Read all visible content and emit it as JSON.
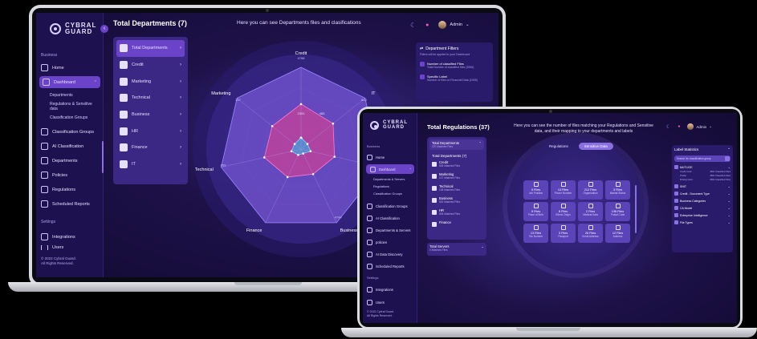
{
  "screen1": {
    "logo": {
      "line1": "CYBRAL",
      "line2": "GUARD"
    },
    "title": "Total Departments (7)",
    "subtitle": "Here you can see Departments files and clasifications",
    "user": "Admin",
    "sidebar": {
      "section_business": "Business",
      "section_settings": "Settings",
      "items": [
        {
          "label": "Home",
          "icon": "home-icon"
        },
        {
          "label": "Dashboard",
          "icon": "chart-icon",
          "active": true
        },
        {
          "label": "Classification Groups",
          "icon": "folder-icon"
        },
        {
          "label": "AI Classification",
          "icon": "ai-icon"
        },
        {
          "label": "Departments",
          "icon": "building-icon"
        },
        {
          "label": "Policies",
          "icon": "doc-icon"
        },
        {
          "label": "Regulations",
          "icon": "scale-icon"
        },
        {
          "label": "Scheduled Reports",
          "icon": "calendar-icon"
        }
      ],
      "dashboard_sub": [
        "Departments",
        "Regulations & Sensitive data",
        "Classification Groups"
      ],
      "settings_items": [
        {
          "label": "Integrations",
          "icon": "plug-icon"
        },
        {
          "label": "Users",
          "icon": "users-icon"
        }
      ],
      "footer": [
        "© 2022 Cybral Guard.",
        "All Rights Reserved."
      ]
    },
    "departments": [
      "Total Departments",
      "Credit",
      "Marketing",
      "Technical",
      "Business",
      "HR",
      "Finance",
      "IT"
    ],
    "radar": {
      "axes": [
        {
          "label": "Credit",
          "value_label": "4768"
        },
        {
          "label": "IT",
          "value_label": "843"
        },
        {
          "label": "HR",
          "value_label": ""
        },
        {
          "label": "Business",
          "value_label": "4744"
        },
        {
          "label": "Finance",
          "value_label": ""
        },
        {
          "label": "Technical",
          "value_label": "659"
        },
        {
          "label": "Marketing",
          "value_label": "357"
        }
      ],
      "ring_labels": [
        "2331",
        "483",
        "73"
      ],
      "colors": {
        "outer": "#6d4fc8",
        "classified": "#c2429a",
        "specific": "#3aa6e0"
      }
    },
    "filter": {
      "title": "Department Filters",
      "subtitle": "Filters will be applied to your Dashboard",
      "options": [
        {
          "label": "Number of classified Files",
          "sub": "Total Number of classified files (3596)"
        },
        {
          "label": "Specific Label",
          "sub": "Number of files on Financial Data (2495)"
        }
      ]
    }
  },
  "screen2": {
    "logo": {
      "line1": "CYBRAL",
      "line2": "GUARD"
    },
    "title": "Total Regulations (37)",
    "subtitle": "Here you can see the number of files matching your Regulations and Sensitive data, and their mapping to your departments and labels",
    "user": "Admin",
    "sidebar": {
      "section_business": "Business",
      "section_settings": "Settings",
      "items": [
        {
          "label": "Home",
          "icon": "home-icon"
        },
        {
          "label": "Dashboard",
          "icon": "chart-icon",
          "active": true
        },
        {
          "label": "Classification Groups",
          "icon": "folder-icon"
        },
        {
          "label": "AI Classification",
          "icon": "ai-icon"
        },
        {
          "label": "Departments & Servers",
          "icon": "building-icon"
        },
        {
          "label": "policies",
          "icon": "doc-icon"
        },
        {
          "label": "AI Data Discovery",
          "icon": "search-icon"
        },
        {
          "label": "Scheduled Reports",
          "icon": "calendar-icon"
        }
      ],
      "dashboard_sub": [
        "Departments & Servers",
        "Regulations",
        "Classification Groups"
      ],
      "settings_items": [
        {
          "label": "Integrations",
          "icon": "plug-icon"
        },
        {
          "label": "Users",
          "icon": "users-icon"
        }
      ],
      "footer": [
        "© 2022 Cybral Guard.",
        "All Rights Reserved."
      ]
    },
    "reg_panel": {
      "head_title": "Total Departments",
      "head_sub": "370 Matched Files",
      "selected": "Total Departments (7)",
      "items": [
        {
          "name": "Credit",
          "files": "505 Matched Files"
        },
        {
          "name": "Marketing",
          "files": "107 Matched Files"
        },
        {
          "name": "Technical",
          "files": "108 Matched Files"
        },
        {
          "name": "Business",
          "files": "815 Matched Files"
        },
        {
          "name": "HR",
          "files": "805 Matched Files"
        },
        {
          "name": "Finance",
          "files": ""
        }
      ],
      "servers_title": "Total Servers",
      "servers_sub": "0 Matched Files"
    },
    "tabs": [
      "Regulations",
      "Sensitive Data"
    ],
    "tiles": [
      {
        "files": "5 Files",
        "name": "Job Position"
      },
      {
        "files": "13 Files",
        "name": "Phone Number"
      },
      {
        "files": "212 Files",
        "name": "Organization"
      },
      {
        "files": "3 Files",
        "name": "Marital Status"
      },
      {
        "files": "5 Files",
        "name": "Place of Birth"
      },
      {
        "files": "8 Files",
        "name": "Ethnic Origin"
      },
      {
        "files": "2 Files",
        "name": "Medical Data"
      },
      {
        "files": "136 Files",
        "name": "Postal Code"
      },
      {
        "files": "13 Files",
        "name": "Tax Number"
      },
      {
        "files": "3 Files",
        "name": "Passport"
      },
      {
        "files": "26 Files",
        "name": "Email Address"
      },
      {
        "files": "12 Files",
        "name": "Address"
      }
    ],
    "label_stats": {
      "title": "Label Statistics",
      "search_placeholder": "Search for classification group",
      "categories": [
        {
          "name": "MUTLIGE",
          "rows": [
            [
              "Credit Card",
              "3591 Classified Files"
            ],
            [
              "Profile",
              "3591 Classified Files"
            ],
            [
              "Driving Card",
              "3591 Classified Files"
            ]
          ]
        },
        {
          "name": "SNIT",
          "rows": []
        },
        {
          "name": "Credit - Document Type",
          "rows": []
        },
        {
          "name": "Business Categories",
          "rows": []
        },
        {
          "name": "CA Model",
          "rows": []
        },
        {
          "name": "Enterprise Intelligence",
          "rows": []
        },
        {
          "name": "File Types",
          "rows": []
        }
      ]
    }
  }
}
